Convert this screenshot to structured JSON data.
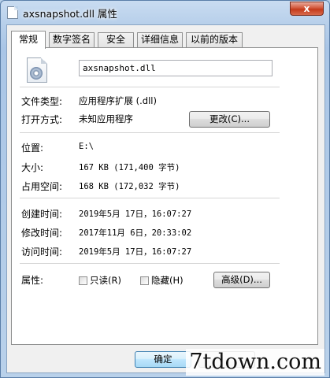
{
  "window": {
    "title": "axsnapshot.dll 属性",
    "close_glyph": "x"
  },
  "tabs": [
    {
      "label": "常规",
      "active": true
    },
    {
      "label": "数字签名",
      "active": false
    },
    {
      "label": "安全",
      "active": false
    },
    {
      "label": "详细信息",
      "active": false
    },
    {
      "label": "以前的版本",
      "active": false
    }
  ],
  "general": {
    "file_name": "axsnapshot.dll",
    "file_type_label": "文件类型:",
    "file_type_value": "应用程序扩展 (.dll)",
    "open_with_label": "打开方式:",
    "open_with_value": "未知应用程序",
    "change_button": "更改(C)...",
    "location_label": "位置:",
    "location_value": "E:\\",
    "size_label": "大小:",
    "size_value": "167 KB (171,400 字节)",
    "size_on_disk_label": "占用空间:",
    "size_on_disk_value": "168 KB (172,032 字节)",
    "created_label": "创建时间:",
    "created_value": "2019年5月 17日，16:07:27",
    "modified_label": "修改时间:",
    "modified_value": "2017年11月 6日，20:33:02",
    "accessed_label": "访问时间:",
    "accessed_value": "2019年5月 17日，16:07:27",
    "attributes_label": "属性:",
    "readonly_label": "只读(R)",
    "hidden_label": "隐藏(H)",
    "advanced_button": "高级(D)..."
  },
  "footer": {
    "ok_button": "确定"
  },
  "watermark": "7tdown.com"
}
